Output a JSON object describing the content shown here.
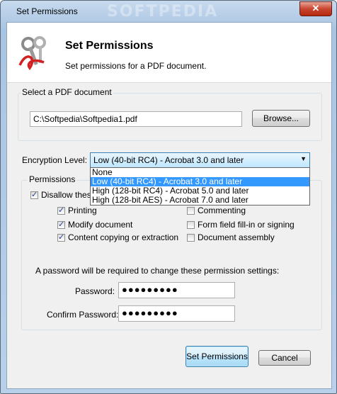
{
  "window": {
    "title": "Set Permissions",
    "watermark": "SOFTPEDIA",
    "close_glyph": "✕"
  },
  "header": {
    "title": "Set Permissions",
    "subtitle": "Set permissions for a PDF document.",
    "icon": "keys-icon"
  },
  "select_pdf": {
    "group_label": "Select a PDF document",
    "path": "C:\\Softpedia\\Softpedia1.pdf",
    "browse_label": "Browse..."
  },
  "encryption": {
    "label": "Encryption Level:",
    "selected": "Low (40-bit RC4) - Acrobat 3.0 and later",
    "options": [
      "None",
      "Low (40-bit RC4) - Acrobat 3.0 and later",
      "High (128-bit RC4) - Acrobat 5.0 and later",
      "High (128-bit AES) - Acrobat 7.0 and later"
    ]
  },
  "permissions": {
    "group_label": "Permissions",
    "disallow_label": "Disallow these",
    "disallow_checked": true,
    "items": [
      {
        "label": "Printing",
        "checked": true
      },
      {
        "label": "Commenting",
        "checked": false
      },
      {
        "label": "Modify document",
        "checked": true
      },
      {
        "label": "Form field fill-in or signing",
        "checked": false
      },
      {
        "label": "Content copying or extraction",
        "checked": true
      },
      {
        "label": "Document assembly",
        "checked": false
      }
    ],
    "password_note": "A password will be required to change these permission settings:",
    "password_label": "Password:",
    "password_value": "●●●●●●●●●",
    "confirm_label": "Confirm Password:",
    "confirm_value": "●●●●●●●●●"
  },
  "buttons": {
    "ok": "Set Permissions",
    "cancel": "Cancel"
  },
  "colors": {
    "selection": "#3399ff",
    "close": "#c9452f"
  }
}
